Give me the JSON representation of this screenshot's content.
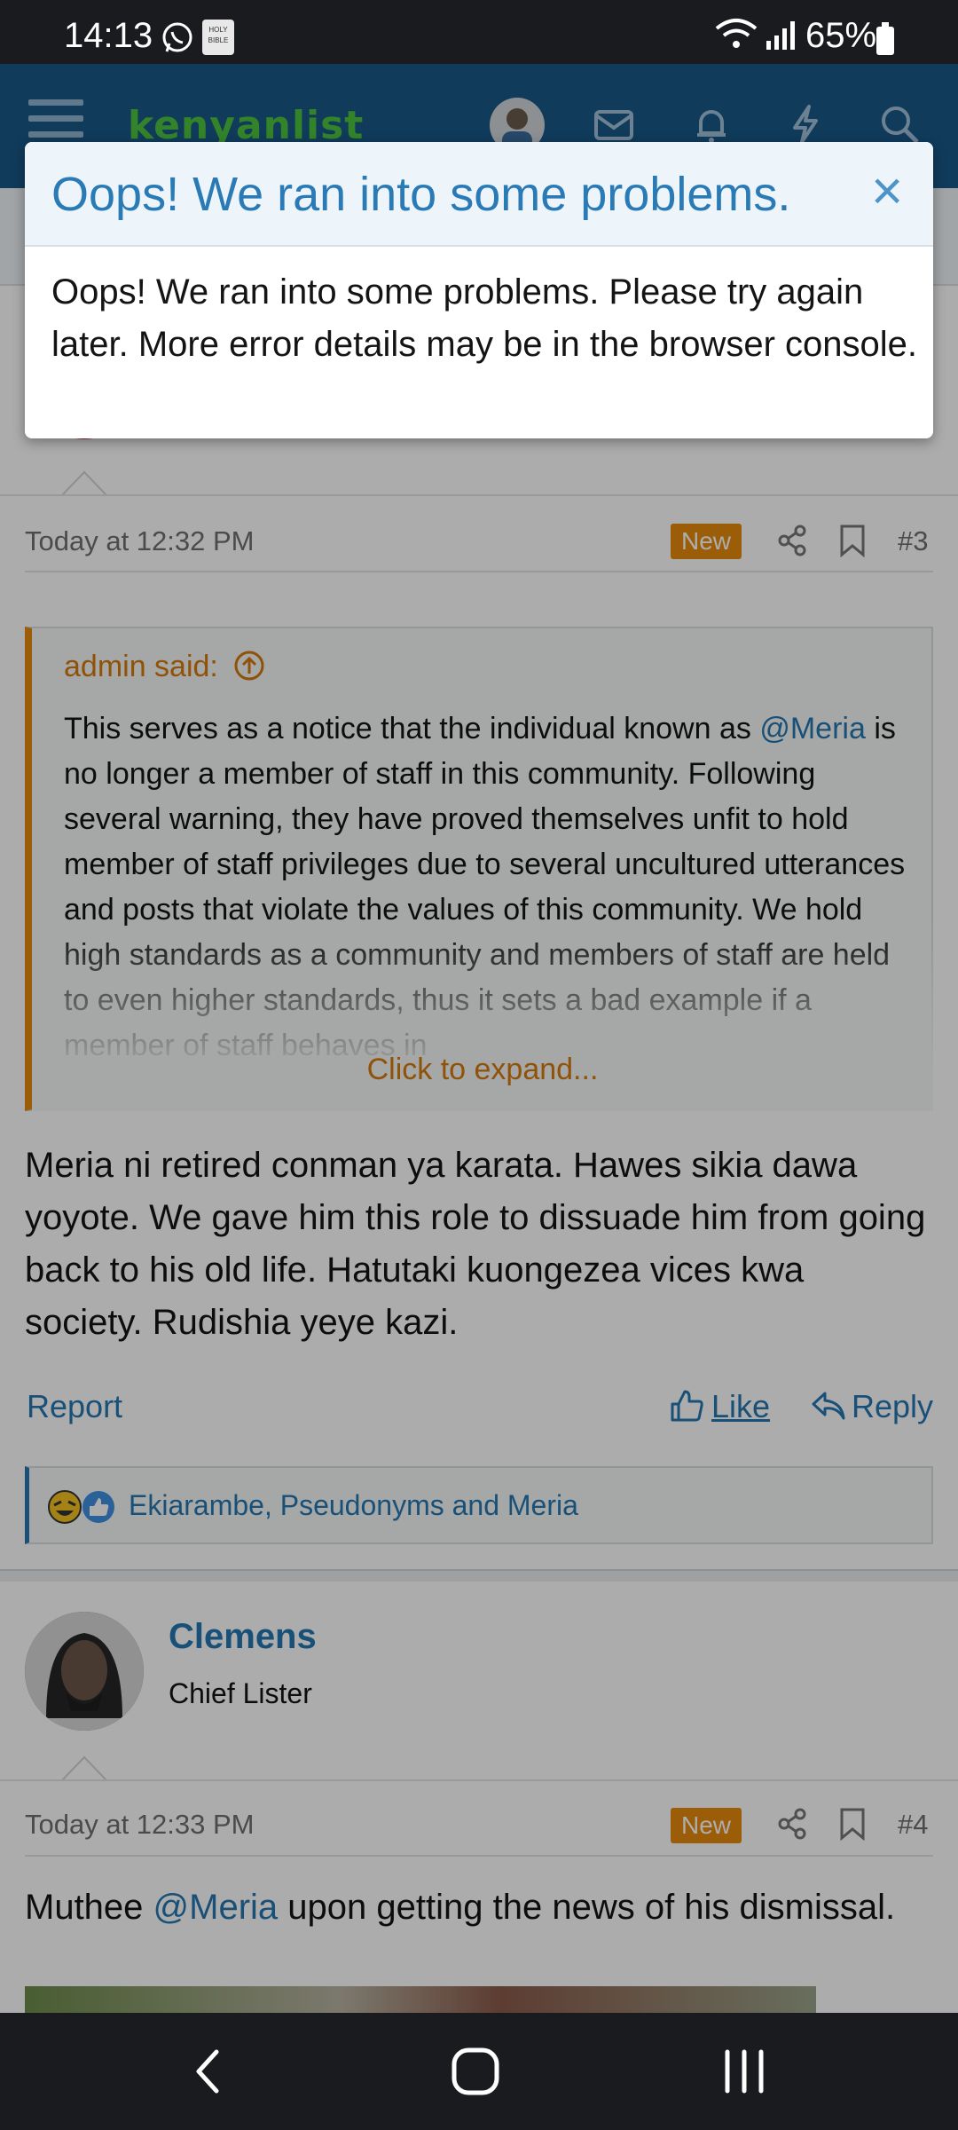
{
  "status_bar": {
    "time": "14:13",
    "battery": "65%",
    "bible_label": "HOLY BIBLE"
  },
  "header": {
    "logo": "kenyanlist"
  },
  "post3": {
    "timestamp": "Today at 12:32 PM",
    "badge": "New",
    "number": "#3",
    "quote": {
      "author": "admin said:",
      "mention": "@Meria",
      "text_before": "This serves as a notice that the individual known as",
      "text_after": "is no longer a member of staff in this community. Following several warning, they have proved themselves unfit to hold member of staff privileges due to several uncultured utterances and posts that violate the values of this community. We hold high standards as a community and members of staff are held to even higher standards, thus it sets a bad example if a member of staff behaves in",
      "expand": "Click to expand..."
    },
    "message": "Meria ni retired conman ya karata. Hawes sikia dawa yoyote. We gave him this role to dissuade him from going back to his old life. Hatutaki kuongezea vices kwa society. Rudishia yeye kazi.",
    "report": "Report",
    "like": "Like",
    "reply": "Reply",
    "reactions": "Ekiarambe, Pseudonyms and Meria"
  },
  "post4": {
    "author": "Clemens",
    "title": "Chief Lister",
    "timestamp": "Today at 12:33 PM",
    "badge": "New",
    "number": "#4",
    "message_start": "Muthee",
    "mention": "@Meria",
    "message_end": "upon getting the news of his dismissal."
  },
  "modal": {
    "title": "Oops! We ran into some problems.",
    "close": "×",
    "body": "Oops! We ran into some problems. Please try again later. More error details may be in the browser console."
  },
  "colors": {
    "nav": "#185886",
    "accent": "#2577b1",
    "badge": "#e58a0c",
    "logo": "#4cc13e"
  }
}
